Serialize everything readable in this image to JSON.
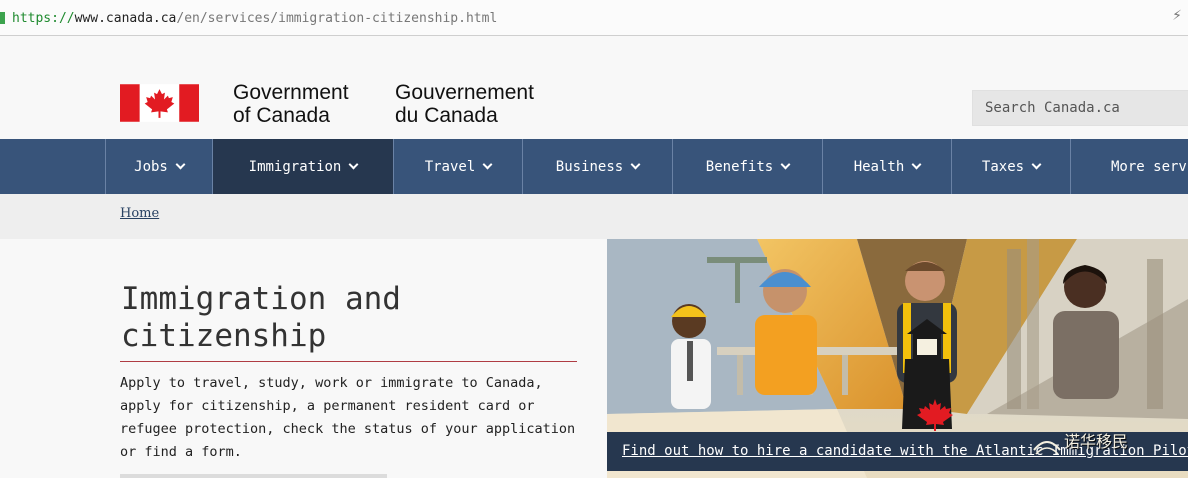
{
  "browser": {
    "url_protocol": "https://",
    "url_host": "www.canada.ca",
    "url_path": "/en/services/immigration-citizenship.html"
  },
  "header": {
    "signature_en_line1": "Government",
    "signature_en_line2": "of Canada",
    "signature_fr_line1": "Gouvernement",
    "signature_fr_line2": "du Canada",
    "search_placeholder": "Search Canada.ca"
  },
  "nav": {
    "items": [
      {
        "label": "Jobs"
      },
      {
        "label": "Immigration",
        "active": true
      },
      {
        "label": "Travel"
      },
      {
        "label": "Business"
      },
      {
        "label": "Benefits"
      },
      {
        "label": "Health"
      },
      {
        "label": "Taxes"
      },
      {
        "label": "More servi"
      }
    ]
  },
  "breadcrumb": {
    "home": "Home"
  },
  "main": {
    "title_line1": "Immigration and",
    "title_line2": "citizenship",
    "intro_lines": [
      "Apply to travel, study, work or immigrate to Canada,",
      "apply for citizenship, a permanent resident card or",
      "refugee protection, check the status of your application",
      "or find a form."
    ]
  },
  "feature": {
    "link_text": "Find out how to hire a candidate with the Atlantic Immigration Pilot",
    "watermark_text": "诺华移民"
  },
  "colors": {
    "nav_bg": "#38547a",
    "nav_active": "#26374f",
    "flag_red": "#e21b22",
    "title_rule": "#af3c43",
    "link": "#284162"
  }
}
